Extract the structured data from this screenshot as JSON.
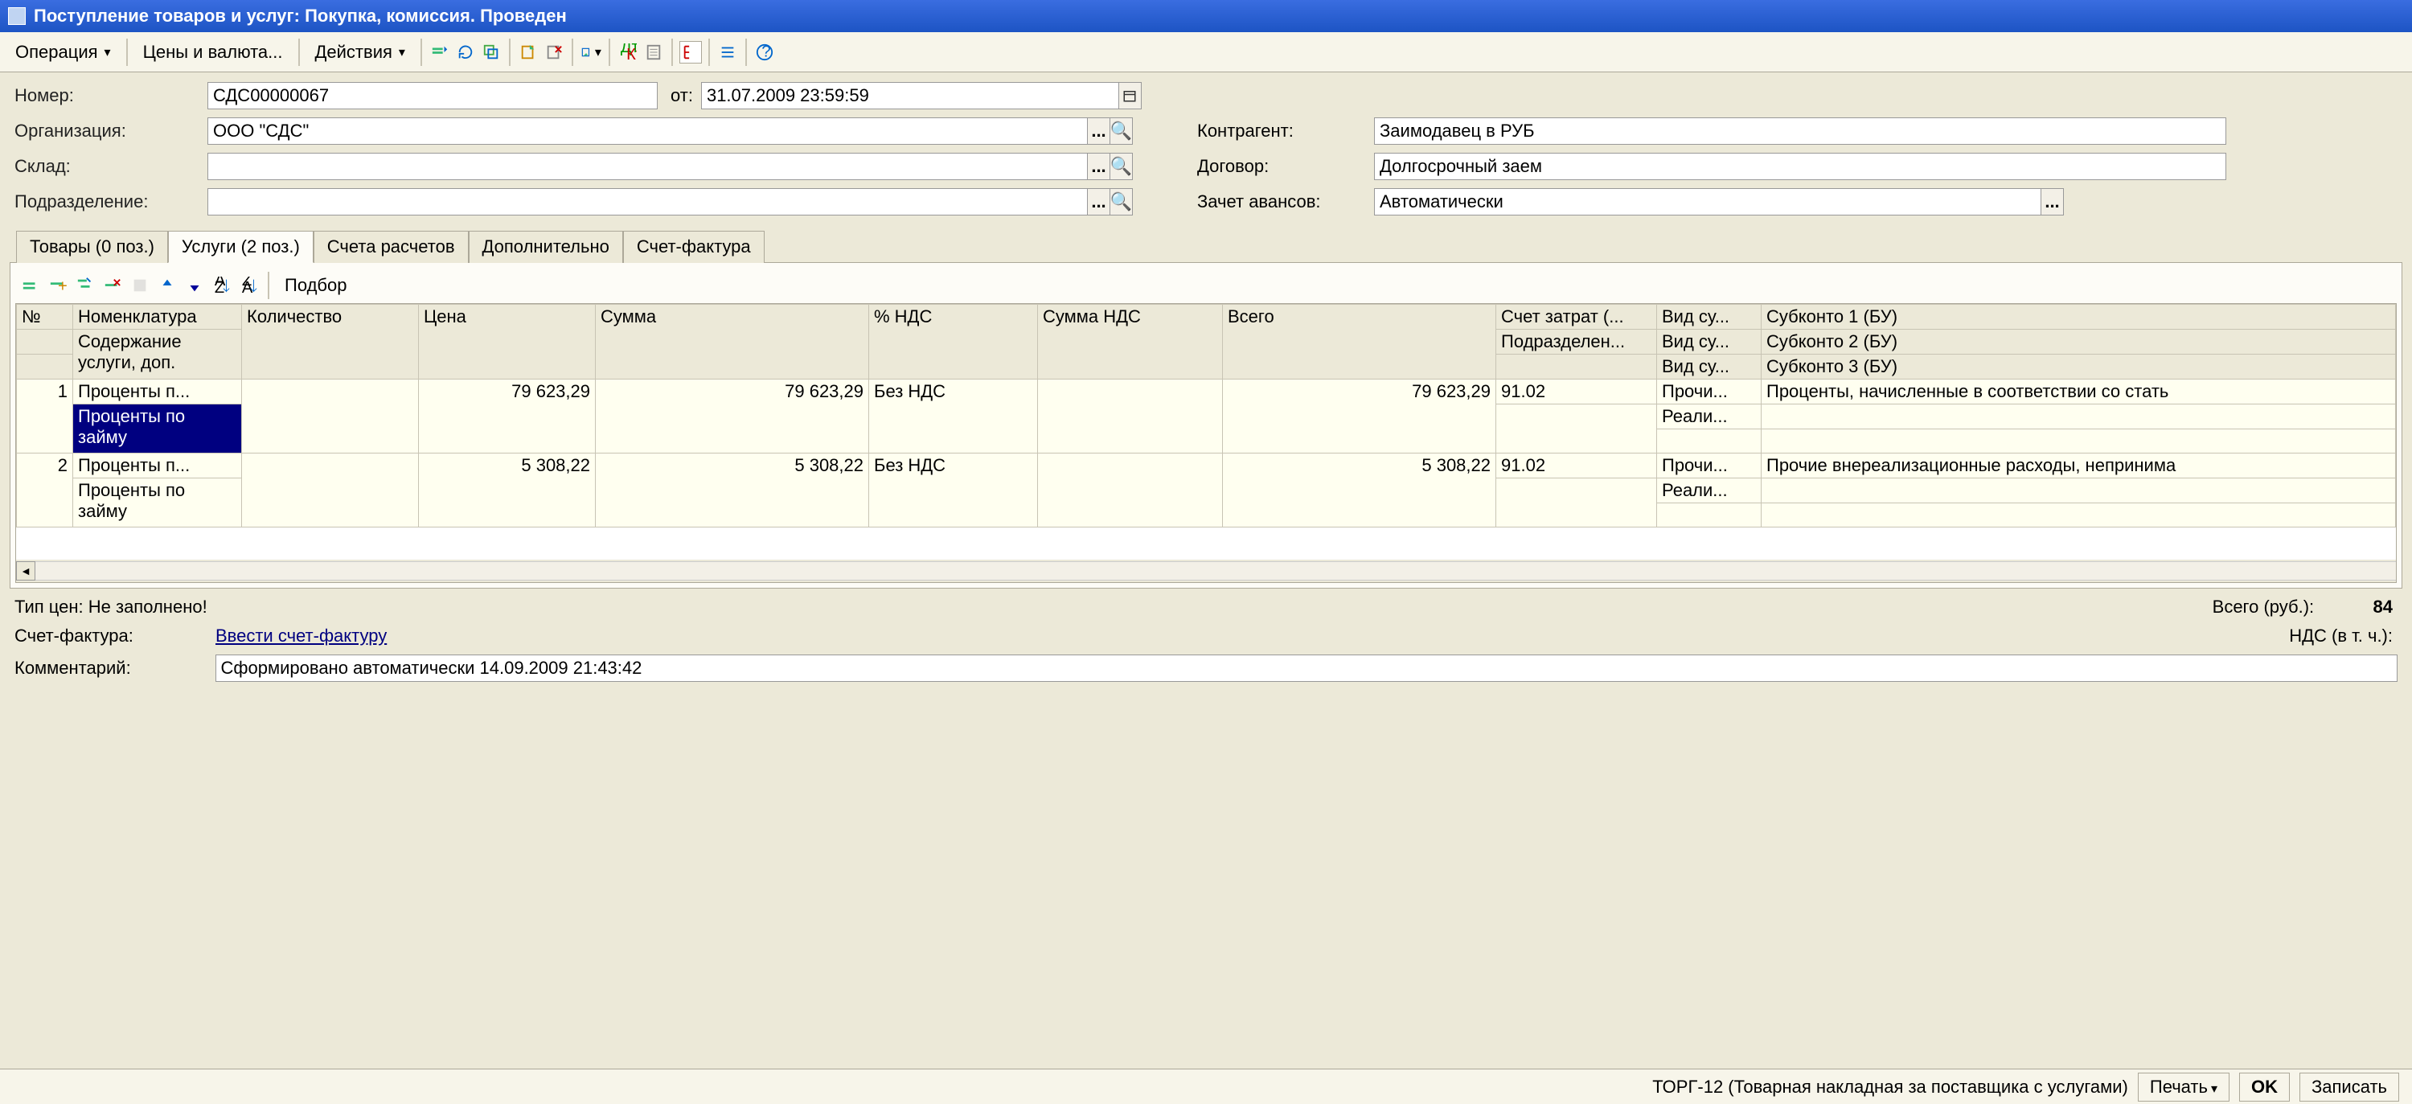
{
  "title": "Поступление товаров и услуг: Покупка, комиссия. Проведен",
  "menu": {
    "operation": "Операция",
    "prices": "Цены и валюта...",
    "actions": "Действия"
  },
  "form": {
    "number_label": "Номер:",
    "number": "СДС00000067",
    "date_label": "от:",
    "date": "31.07.2009 23:59:59",
    "org_label": "Организация:",
    "org": "ООО \"СДС\"",
    "warehouse_label": "Склад:",
    "warehouse": "",
    "dept_label": "Подразделение:",
    "dept": "",
    "counter_label": "Контрагент:",
    "counter": "Заимодавец в РУБ",
    "contract_label": "Договор:",
    "contract": "Долгосрочный заем",
    "advance_label": "Зачет авансов:",
    "advance": "Автоматически"
  },
  "tabs": [
    "Товары (0 поз.)",
    "Услуги (2 поз.)",
    "Счета расчетов",
    "Дополнительно",
    "Счет-фактура"
  ],
  "grid_toolbar": {
    "select": "Подбор"
  },
  "grid": {
    "headers1": [
      "№",
      "Номенклатура",
      "Количество",
      "Цена",
      "Сумма",
      "% НДС",
      "Сумма НДС",
      "Всего",
      "Счет затрат (...",
      "Вид су...",
      "Субконто 1 (БУ)"
    ],
    "headers2": [
      "",
      "Содержание услуги, доп.",
      "",
      "",
      "",
      "",
      "",
      "",
      "Подразделен...",
      "Вид су...",
      "Субконто 2 (БУ)"
    ],
    "headers3": [
      "",
      "",
      "",
      "",
      "",
      "",
      "",
      "",
      "",
      "Вид су...",
      "Субконто 3 (БУ)"
    ],
    "rows": [
      {
        "n": "1",
        "nomen": "Проценты п...",
        "desc": "Проценты по займу",
        "qty": "",
        "price": "79 623,29",
        "sum": "79 623,29",
        "vat": "Без НДС",
        "vatsum": "",
        "total": "79 623,29",
        "acc": "91.02",
        "vid1": "Прочи...",
        "vid2": "Реали...",
        "sub1": "Проценты, начисленные в соответствии со стать",
        "sub2": ""
      },
      {
        "n": "2",
        "nomen": "Проценты п...",
        "desc": "Проценты по займу",
        "qty": "",
        "price": "5 308,22",
        "sum": "5 308,22",
        "vat": "Без НДС",
        "vatsum": "",
        "total": "5 308,22",
        "acc": "91.02",
        "vid1": "Прочи...",
        "vid2": "Реали...",
        "sub1": "Прочие внереализационные расходы, непринима",
        "sub2": ""
      }
    ]
  },
  "footer": {
    "pricetype": "Тип цен: Не заполнено!",
    "invoice_label": "Счет-фактура:",
    "invoice_link": "Ввести счет-фактуру",
    "comment_label": "Комментарий:",
    "comment": "Сформировано автоматически 14.09.2009 21:43:42",
    "total_label": "Всего (руб.):",
    "total_value": "84",
    "vat_label": "НДС (в т. ч.):"
  },
  "status": {
    "torg": "ТОРГ-12 (Товарная накладная за поставщика с услугами)",
    "print": "Печать",
    "ok": "OK",
    "save": "Записать"
  }
}
